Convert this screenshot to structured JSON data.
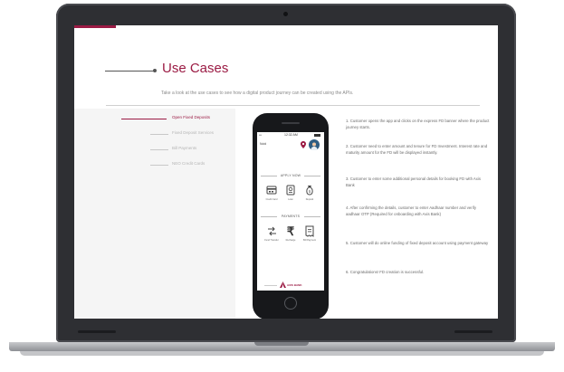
{
  "page": {
    "title": "Use Cases",
    "subtitle": "Take a look at the use cases to see how a digital product journey can be created using the APIs."
  },
  "nav": {
    "items": [
      {
        "label": "Open Fixed Deposits",
        "active": true
      },
      {
        "label": "Fixed Deposit Services",
        "active": false
      },
      {
        "label": "Bill Payments",
        "active": false
      },
      {
        "label": "NEO Credit Cards",
        "active": false
      }
    ]
  },
  "phone": {
    "time": "12:32 AM",
    "signal": "•••",
    "location": "Noid",
    "apply_heading": "APPLY NOW",
    "apply_tiles": [
      {
        "label": "Credit Card",
        "icon": "credit-card-icon"
      },
      {
        "label": "Loan",
        "icon": "loan-icon"
      },
      {
        "label": "Deposit",
        "icon": "deposit-icon"
      }
    ],
    "payments_heading": "PAYMENTS",
    "payment_tiles": [
      {
        "label": "Fund Transfer",
        "icon": "fund-transfer-icon"
      },
      {
        "label": "Recharge",
        "icon": "rupee-icon",
        "glyph": "₹"
      },
      {
        "label": "Bill Payment",
        "icon": "bill-payment-icon"
      }
    ],
    "brand": "AXIS BANK"
  },
  "steps": [
    "1. Customer opens the app and clicks on the express FD banner where the product journey starts.",
    "2. Customer need to enter amount and tenure for FD Investment. Interest rate and maturity amount for the FD will be displayed instantly.",
    "3. Customer to enter some additional personal details for booking FD with Axis Bank",
    "4. After confirming the details, customer to enter Aadhaar number and verify aadhaar OTP (Required for onboarding with Axis Bank)",
    "5. Customer will do online funding of fixed deposit account using payment gateway",
    "6. Congratulations! FD creation is successful."
  ],
  "colors": {
    "accent": "#9b1b44",
    "laptop_body": "#2e2f33"
  }
}
